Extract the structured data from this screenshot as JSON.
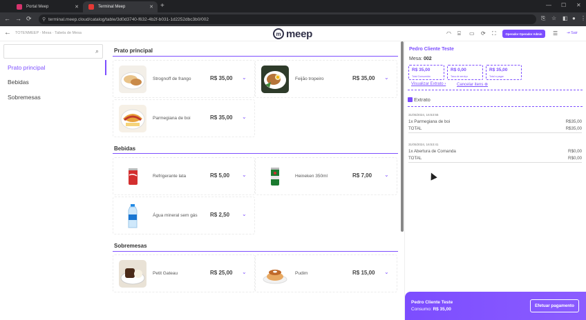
{
  "browser": {
    "tabs": [
      {
        "label": "Portal Meep",
        "fav_color": "#d6336c"
      },
      {
        "label": "Terminal Meep",
        "fav_color": "#e53935"
      }
    ],
    "url": "terminal.meep.cloud/catalog/table/3d0d3740-f632-4b2f-b031-1d2252dbc3b0/002"
  },
  "header": {
    "back_icon": "arrow-left-icon",
    "breadcrumb": "TOTENMEEP · Mesa · Tabela de Mesa",
    "logo_text": "meep",
    "operator_button": "Operador Operador Admin",
    "exit_label": "Sair"
  },
  "sidebar": {
    "search_placeholder": "",
    "categories": [
      {
        "label": "Prato principal"
      },
      {
        "label": "Bebidas"
      },
      {
        "label": "Sobremesas"
      }
    ]
  },
  "sections": [
    {
      "title": "Prato principal",
      "items": [
        {
          "name": "Strognoff de frango",
          "price": "R$ 35,00"
        },
        {
          "name": "Feijão tropeiro",
          "price": "R$ 35,00"
        },
        {
          "name": "Parmegiana de boi",
          "price": "R$ 35,00"
        }
      ]
    },
    {
      "title": "Bebidas",
      "items": [
        {
          "name": "Refrigerante lata",
          "price": "R$ 5,00"
        },
        {
          "name": "Heineken 350ml",
          "price": "R$ 7,00"
        },
        {
          "name": "Água mineral sem gás",
          "price": "R$ 2,50"
        }
      ]
    },
    {
      "title": "Sobremesas",
      "items": [
        {
          "name": "Petit Gateau",
          "price": "R$ 25,00"
        },
        {
          "name": "Pudim",
          "price": "R$ 15,00"
        }
      ]
    }
  ],
  "panel": {
    "client_name": "Pedro Cliente Teste",
    "mesa_label": "Mesa:",
    "mesa_number": "002",
    "summary": [
      {
        "value": "R$ 35,00",
        "label": "Total Consumido"
      },
      {
        "value": "R$ 0,00",
        "label": "Taxa de serviço"
      },
      {
        "value": "R$ 35,00",
        "label": "Total a pagar"
      }
    ],
    "view_statement": "Visualizar Extrato",
    "cancel_items": "Cancelar itens",
    "statement_title": "Extrato",
    "entries": [
      {
        "date": "31/05/2024, 16:53:55",
        "item": "1x Parmegiana de boi",
        "amount": "R$35,00",
        "total_label": "TOTAL",
        "total": "R$35,00"
      },
      {
        "date": "31/05/2024, 16:53:41",
        "item": "1x Abertura de Comanda",
        "amount": "R$0,00",
        "total_label": "TOTAL",
        "total": "R$0,00"
      }
    ]
  },
  "bottom": {
    "client_name": "Pedro Cliente Teste",
    "consumption_label": "Consumo:",
    "consumption_value": "R$ 35,00",
    "pay_button": "Efetuar pagamento"
  },
  "colors": {
    "accent": "#7c4dff",
    "chrome_dark": "#202124"
  }
}
